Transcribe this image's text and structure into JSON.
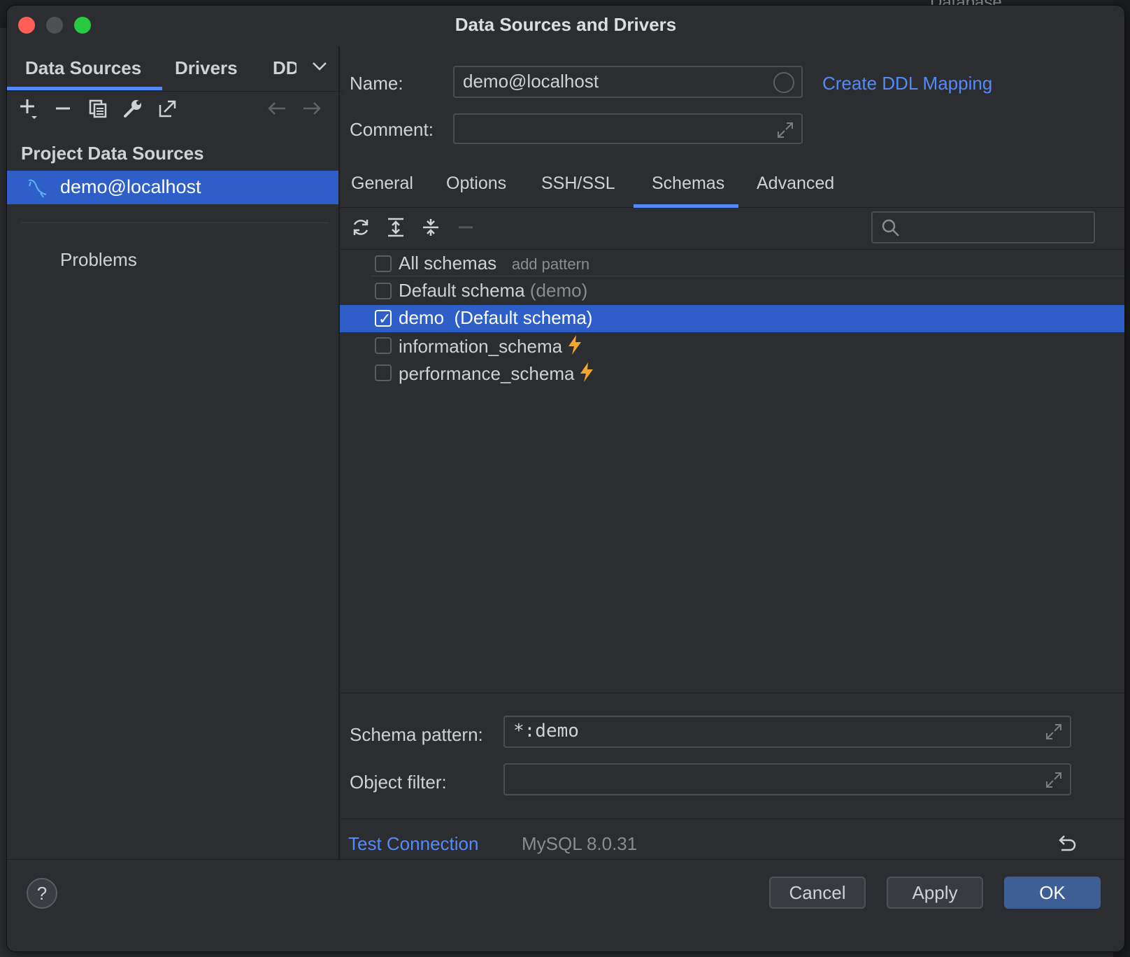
{
  "background": {
    "menu_text": "Database"
  },
  "window": {
    "title": "Data Sources and Drivers"
  },
  "sidebar": {
    "tabs": [
      {
        "label": "Data Sources",
        "active": true
      },
      {
        "label": "Drivers"
      },
      {
        "label": "DD"
      }
    ],
    "toolbar": [
      "add-icon",
      "remove-icon",
      "duplicate-icon",
      "settings-wrench-icon",
      "export-icon",
      "back-arrow-icon",
      "forward-arrow-icon"
    ],
    "section_title": "Project Data Sources",
    "items": [
      {
        "label": "demo@localhost",
        "selected": true,
        "icon": "mysql-dolphin-icon"
      }
    ],
    "problems_label": "Problems"
  },
  "form": {
    "name_label": "Name:",
    "name_value": "demo@localhost",
    "comment_label": "Comment:",
    "comment_value": "",
    "ddl_link": "Create DDL Mapping"
  },
  "tabs": [
    {
      "label": "General"
    },
    {
      "label": "Options"
    },
    {
      "label": "SSH/SSL"
    },
    {
      "label": "Schemas",
      "active": true
    },
    {
      "label": "Advanced"
    }
  ],
  "schemas": {
    "toolbar": [
      "refresh-icon",
      "expand-all-icon",
      "collapse-all-icon",
      "minus-icon"
    ],
    "search_placeholder": "",
    "rows": [
      {
        "label": "All schemas",
        "hint": "add pattern",
        "checked": false
      },
      {
        "label": "Default schema",
        "suffix": "(demo)",
        "checked": false
      },
      {
        "label": "demo",
        "suffix": "(Default schema)",
        "checked": true,
        "selected": true
      },
      {
        "label": "information_schema",
        "bolt": true,
        "checked": false
      },
      {
        "label": "performance_schema",
        "bolt": true,
        "checked": false
      }
    ]
  },
  "pattern": {
    "schema_pattern_label": "Schema pattern:",
    "schema_pattern_value": "*:demo",
    "object_filter_label": "Object filter:",
    "object_filter_value": ""
  },
  "status": {
    "test_connection": "Test Connection",
    "version": "MySQL 8.0.31"
  },
  "footer": {
    "help": "?",
    "cancel": "Cancel",
    "apply": "Apply",
    "ok": "OK"
  },
  "colors": {
    "accent": "#548af7",
    "selection": "#2e5ec8",
    "bolt": "#f0a732",
    "background": "#2b2d30"
  }
}
